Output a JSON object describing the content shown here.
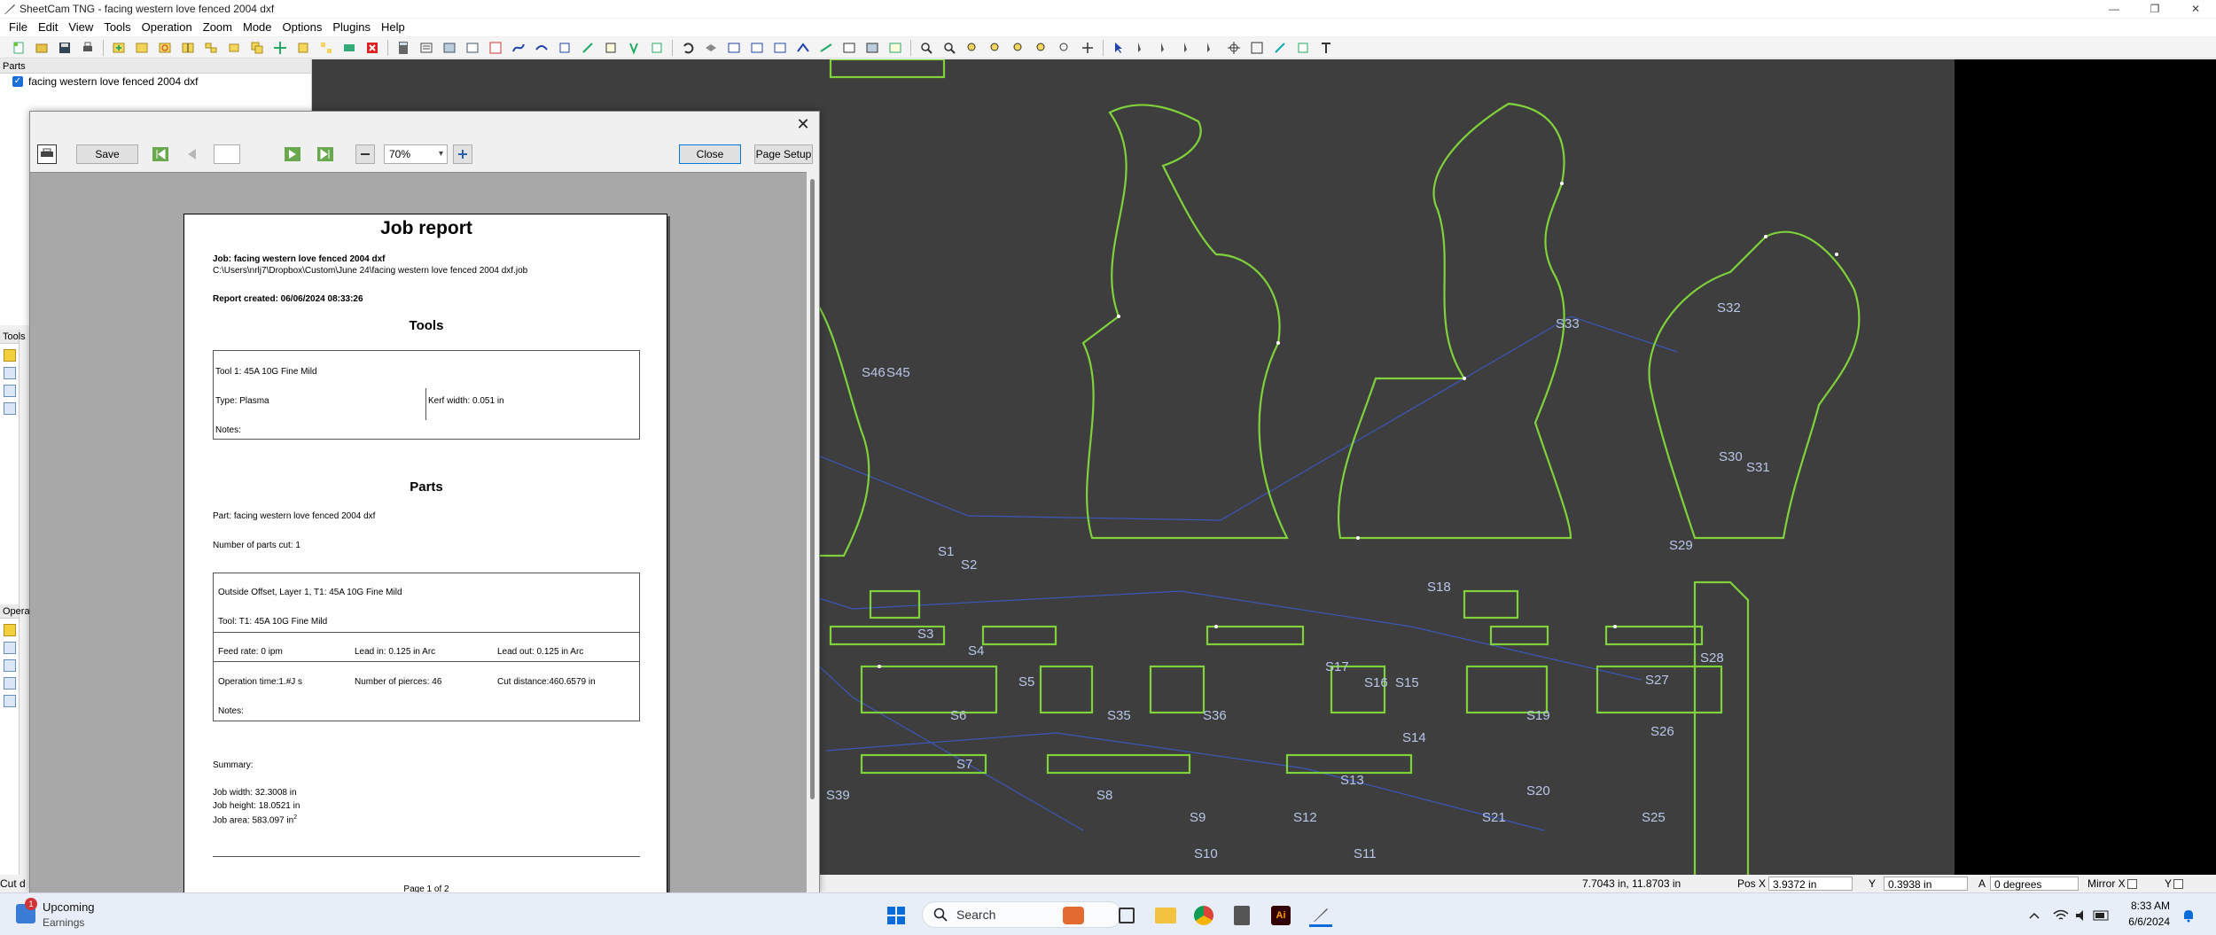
{
  "window": {
    "title": "SheetCam TNG - facing western love fenced 2004 dxf",
    "controls": [
      "—",
      "❐",
      "✕"
    ]
  },
  "menu": [
    "File",
    "Edit",
    "View",
    "Tools",
    "Operation",
    "Zoom",
    "Mode",
    "Options",
    "Plugins",
    "Help"
  ],
  "panels": {
    "parts_title": "Parts",
    "part_item": "facing western love fenced 2004 dxf",
    "tools_title": "Tools",
    "ops_title": "Opera",
    "cut_label": "Cut d"
  },
  "dialog": {
    "save_label": "Save",
    "zoom_value": "70%",
    "close_label": "Close",
    "page_setup_label": "Page Setup",
    "close_x": "✕"
  },
  "report": {
    "title": "Job report",
    "job_line": "Job: facing western love fenced 2004 dxf",
    "job_path": "C:\\Users\\nrlj7\\Dropbox\\Custom\\June 24\\facing western love fenced 2004 dxf.job",
    "created": "Report created: 06/06/2024 08:33:26",
    "tools_heading": "Tools",
    "tool_name": "Tool 1: 45A 10G Fine Mild",
    "tool_type": "Type: Plasma",
    "kerf": "Kerf width: 0.051 in",
    "notes": "Notes:",
    "parts_heading": "Parts",
    "part_line": "Part: facing western love fenced 2004 dxf",
    "parts_cut": "Number of parts cut: 1",
    "op_name": "Outside Offset, Layer 1, T1: 45A 10G Fine Mild",
    "op_tool": "Tool: T1: 45A 10G Fine Mild",
    "feed_rate": "Feed rate: 0 ipm",
    "lead_in": "Lead in: 0.125 in Arc",
    "lead_out": "Lead out: 0.125 in Arc",
    "op_time": "Operation time:1.#J s",
    "pierces": "Number of pierces: 46",
    "cut_distance": "Cut distance:460.6579 in",
    "op_notes": "Notes:",
    "summary": "Summary:",
    "job_width": "Job width: 32.3008 in",
    "job_height": "Job height: 18.0521 in",
    "job_area": "Job area: 583.097 in",
    "job_area_sup": "2",
    "page_footer": "Page 1 of 2"
  },
  "canvas_labels": [
    "S1",
    "S2",
    "S3",
    "S4",
    "S5",
    "S6",
    "S7",
    "S8",
    "S9",
    "S10",
    "S11",
    "S12",
    "S13",
    "S14",
    "S15",
    "S16",
    "S17",
    "S18",
    "S19",
    "S20",
    "S21",
    "S25",
    "S26",
    "S27",
    "S28",
    "S29",
    "S30",
    "S31",
    "S32",
    "S33",
    "S35",
    "S36",
    "S39",
    "S45",
    "S46"
  ],
  "status": {
    "coords": "7.7043 in, 11.8703 in",
    "pos_x_label": "Pos X",
    "pos_x": "3.9372 in",
    "y_label": "Y",
    "y_val": "0.3938 in",
    "a_label": "A",
    "a_val": "0 degrees",
    "mirror_x": "Mirror X",
    "mirror_y": "Y"
  },
  "taskbar": {
    "weather_title": "Upcoming",
    "weather_sub": "Earnings",
    "badge": "1",
    "search_placeholder": "Search",
    "time": "8:33 AM",
    "date": "6/6/2024"
  },
  "colors": {
    "canvas_bg": "#3e3e3e",
    "cut_path": "#7fd23a",
    "rapid_path": "#3c57b8",
    "dialog_bg": "#f0f0f0"
  }
}
